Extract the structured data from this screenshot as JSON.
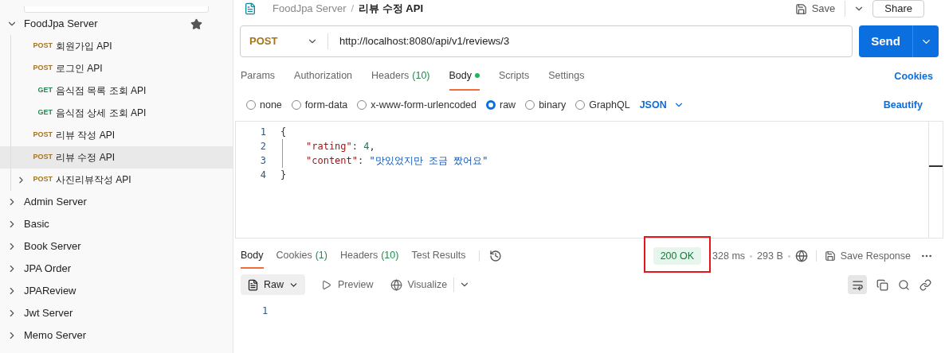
{
  "sidebar": {
    "collections": [
      {
        "name": "FoodJpa Server",
        "expanded": true,
        "starred": true,
        "children": [
          {
            "method": "POST",
            "name": "회원가입 API",
            "selected": false
          },
          {
            "method": "POST",
            "name": "로그인 API",
            "selected": false
          },
          {
            "method": "GET",
            "name": "음식점 목록 조회 API",
            "selected": false
          },
          {
            "method": "GET",
            "name": "음식점 상세 조회 API",
            "selected": false
          },
          {
            "method": "POST",
            "name": "리뷰 작성 API",
            "selected": false
          },
          {
            "method": "POST",
            "name": "리뷰 수정 API",
            "selected": true
          },
          {
            "method": "POST",
            "name": "사진리뷰작성 API",
            "selected": false,
            "expanded": false
          }
        ]
      },
      {
        "name": "Admin Server",
        "expanded": false,
        "starred": false
      },
      {
        "name": "Basic",
        "expanded": false,
        "starred": false
      },
      {
        "name": "Book Server",
        "expanded": false,
        "starred": false
      },
      {
        "name": "JPA Order",
        "expanded": false,
        "starred": false
      },
      {
        "name": "JPAReview",
        "expanded": false,
        "starred": false
      },
      {
        "name": "Jwt Server",
        "expanded": false,
        "starred": false
      },
      {
        "name": "Memo Server",
        "expanded": false,
        "starred": false
      }
    ]
  },
  "header": {
    "breadcrumb": [
      "FoodJpa Server",
      "리뷰 수정 API"
    ],
    "separator": "/",
    "save": "Save",
    "share": "Share"
  },
  "request": {
    "method": "POST",
    "url": "http://localhost:8080/api/v1/reviews/3",
    "send": "Send",
    "tabs": [
      {
        "label": "Params",
        "selected": false
      },
      {
        "label": "Authorization",
        "selected": false
      },
      {
        "label": "Headers",
        "count": "(10)",
        "selected": false
      },
      {
        "label": "Body",
        "selected": true,
        "dot": true
      },
      {
        "label": "Scripts",
        "selected": false
      },
      {
        "label": "Settings",
        "selected": false
      }
    ],
    "cookies": "Cookies",
    "body_types": [
      {
        "label": "none",
        "selected": false
      },
      {
        "label": "form-data",
        "selected": false
      },
      {
        "label": "x-www-form-urlencoded",
        "selected": false
      },
      {
        "label": "raw",
        "selected": true
      },
      {
        "label": "binary",
        "selected": false
      },
      {
        "label": "GraphQL",
        "selected": false
      }
    ],
    "format": "JSON",
    "beautify": "Beautify",
    "code": [
      {
        "num": "1",
        "tokens": [
          {
            "kind": "punct",
            "text": "{"
          }
        ]
      },
      {
        "num": "2",
        "tokens": [
          {
            "kind": "key",
            "text": "\"rating\""
          },
          {
            "kind": "punct",
            "text": ": "
          },
          {
            "kind": "number",
            "text": "4"
          },
          {
            "kind": "punct",
            "text": ","
          }
        ]
      },
      {
        "num": "3",
        "tokens": [
          {
            "kind": "key",
            "text": "\"content\""
          },
          {
            "kind": "punct",
            "text": ": "
          },
          {
            "kind": "string",
            "text": "\"맛있었지만 조금 짰어요\""
          }
        ]
      },
      {
        "num": "4",
        "tokens": [
          {
            "kind": "punct",
            "text": "}"
          }
        ]
      }
    ]
  },
  "response": {
    "tabs": [
      {
        "label": "Body",
        "selected": true
      },
      {
        "label": "Cookies",
        "count": "(1)",
        "selected": false
      },
      {
        "label": "Headers",
        "count": "(10)",
        "selected": false
      },
      {
        "label": "Test Results",
        "selected": false
      }
    ],
    "status": "200 OK",
    "status_highlighted": true,
    "time": "328 ms",
    "size": "293 B",
    "save_response": "Save Response",
    "view": "Raw",
    "preview": "Preview",
    "visualize": "Visualize",
    "lines": [
      "1"
    ]
  }
}
